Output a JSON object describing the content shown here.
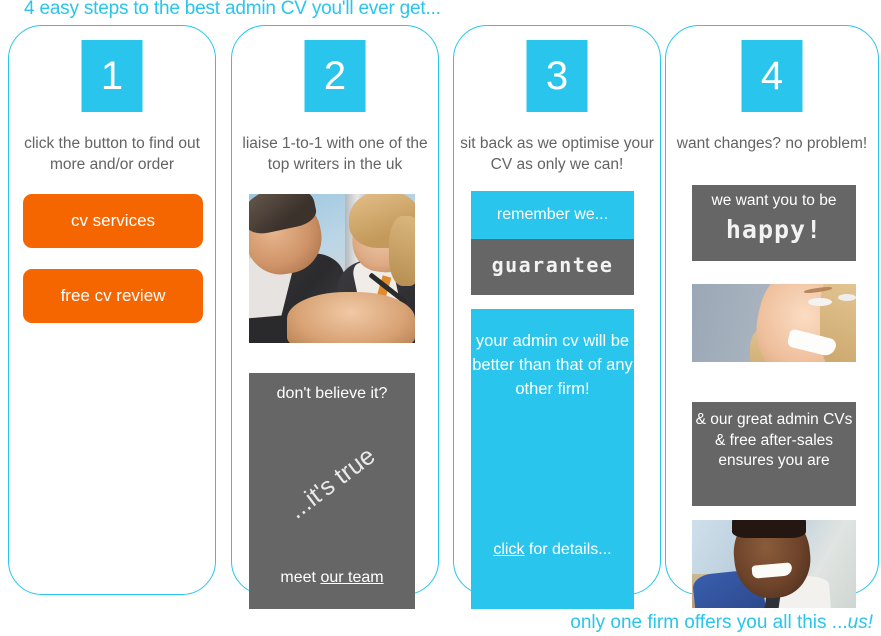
{
  "header": {
    "title": "4 easy steps to the best admin CV you'll ever get..."
  },
  "footer": {
    "text_prefix": "only one firm offers you all this ...",
    "text_emphasis": "us!"
  },
  "steps": [
    {
      "number": "1",
      "caption": "click the button to find out more and/or order",
      "buttons": [
        {
          "label": "cv services"
        },
        {
          "label": "free cv review"
        }
      ]
    },
    {
      "number": "2",
      "caption": "liaise 1-to-1 with one of the top writers in the uk",
      "photo_alt": "two-people-meeting-photo",
      "panel": {
        "headline": "don't believe it?",
        "diagonal": "...it's true",
        "footer_prefix": "meet ",
        "footer_link": "our team"
      }
    },
    {
      "number": "3",
      "caption": "sit back as we optimise your CV as only we can!",
      "panels": [
        {
          "label": "remember we...",
          "style": "cyan"
        },
        {
          "label": "guarantee",
          "style": "gray"
        }
      ],
      "promise": {
        "text": "your admin cv will be better than that of any other firm!",
        "cta_link": "click",
        "cta_rest": " for details..."
      }
    },
    {
      "number": "4",
      "caption": "want changes? no problem!",
      "happy_panel": {
        "line1": "we want you to be",
        "line2": "happy!"
      },
      "photo_laugh_alt": "laughing-woman-photo",
      "great_panel": {
        "text": "& our great admin CVs & free after-sales ensures you are"
      },
      "photo_man_alt": "smiling-man-photo"
    }
  ],
  "colors": {
    "cyan": "#29C5EC",
    "orange": "#F56600",
    "gray": "#666666",
    "caption_text": "#636363"
  }
}
